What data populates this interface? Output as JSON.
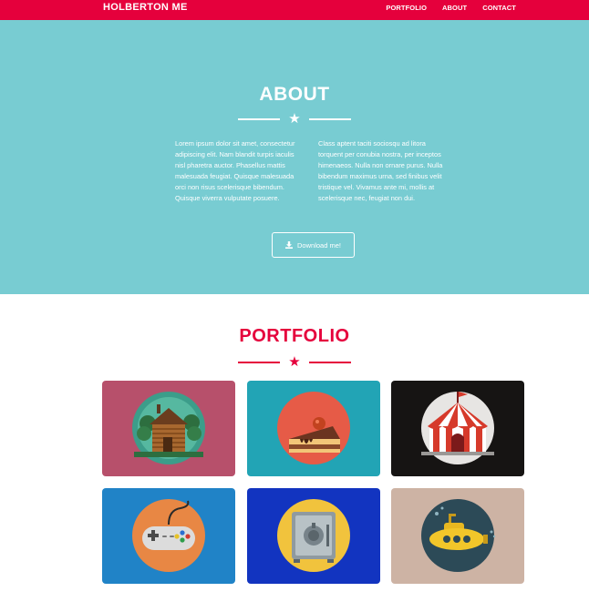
{
  "navbar": {
    "brand": "HOLBERTON ME",
    "links": [
      "PORTFOLIO",
      "ABOUT",
      "CONTACT"
    ],
    "color": "#e5003c"
  },
  "about": {
    "title": "ABOUT",
    "background": "#78ccd2",
    "col_left": "Lorem ipsum dolor sit amet, consectetur adipiscing elit. Nam blandit turpis iaculis nisl pharetra auctor. Phasellus mattis malesuada feugiat. Quisque malesuada orci non risus scelerisque bibendum. Quisque viverra vulputate posuere.",
    "col_right": "Class aptent taciti sociosqu ad litora torquent per conubia nostra, per inceptos himenaeos. Nulla non ornare purus. Nulla bibendum maximus urna, sed finibus velit tristique vel. Vivamus ante mi, mollis at scelerisque nec, feugiat non dui.",
    "download_label": "Download me!",
    "download_icon": "download-icon"
  },
  "portfolio": {
    "title": "PORTFOLIO",
    "items": [
      {
        "icon": "cabin-icon",
        "bg": "#b7506b"
      },
      {
        "icon": "cake-icon",
        "bg": "#22a4b5"
      },
      {
        "icon": "circus-tent-icon",
        "bg": "#161413"
      },
      {
        "icon": "game-controller-icon",
        "bg": "#2083c7"
      },
      {
        "icon": "safe-icon",
        "bg": "#1234c0"
      },
      {
        "icon": "submarine-icon",
        "bg": "#cdb3a4"
      }
    ]
  }
}
